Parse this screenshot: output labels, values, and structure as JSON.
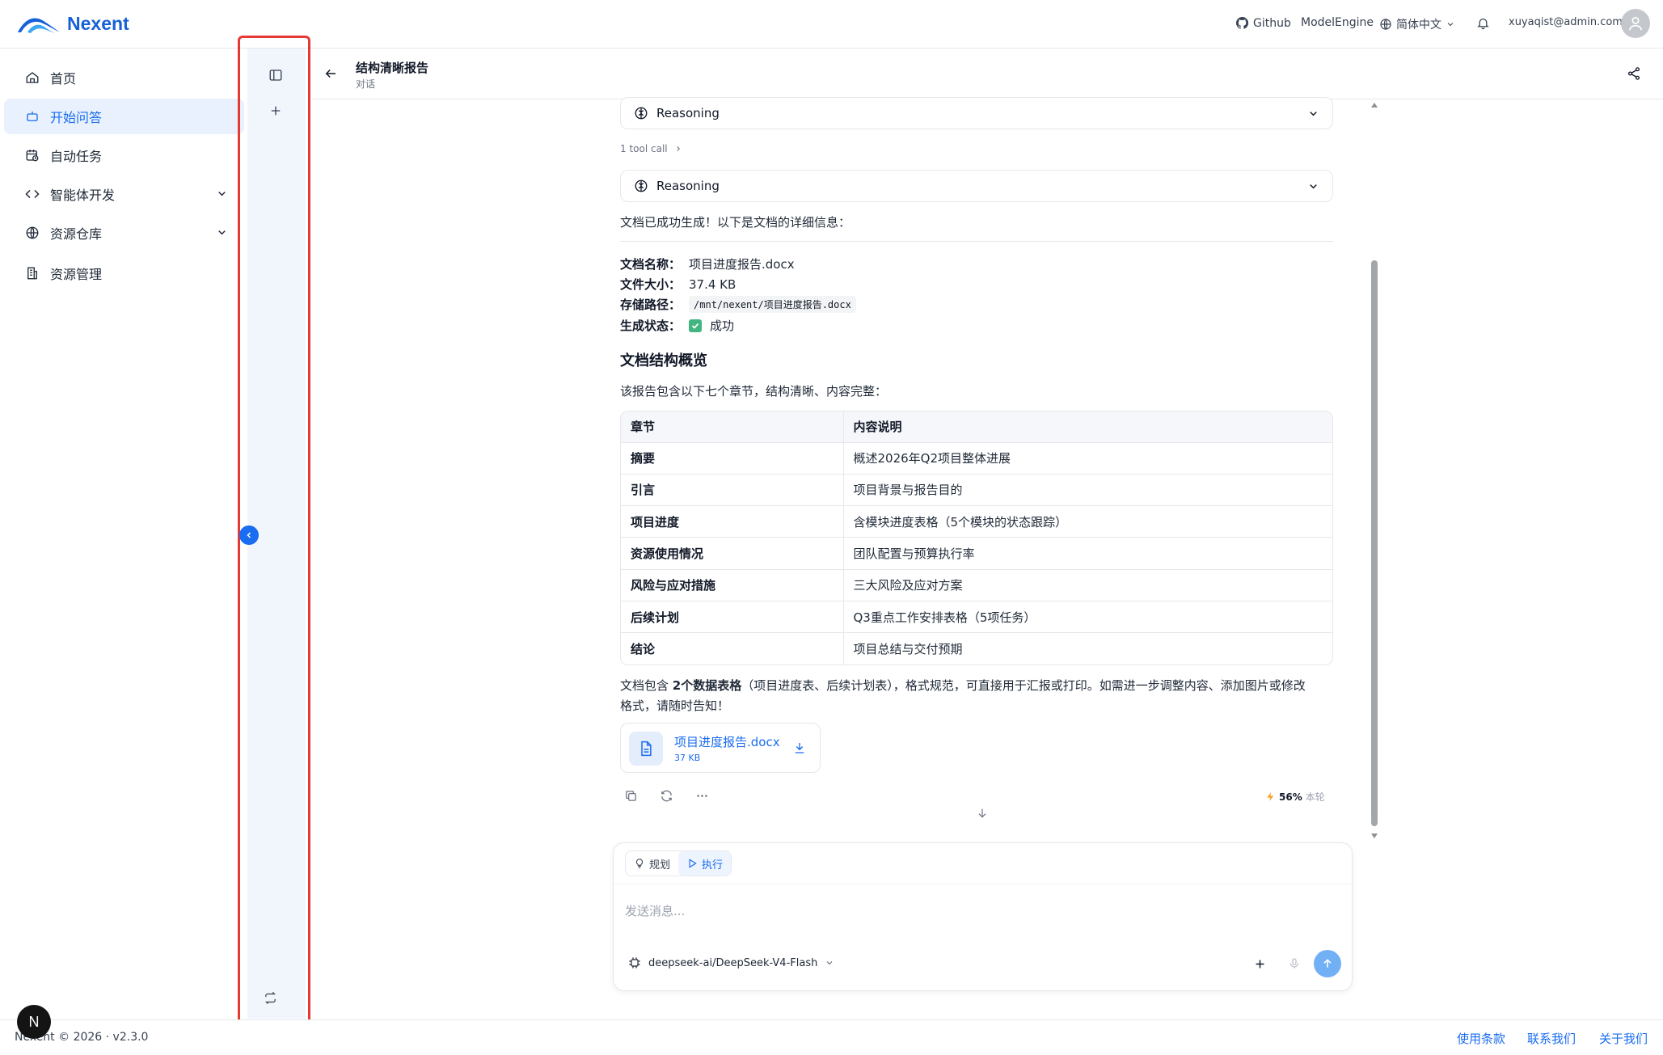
{
  "app": {
    "name": "Nexent"
  },
  "header": {
    "github": "Github",
    "model_engine": "ModelEngine",
    "language": "简体中文",
    "user_email": "xuyaqist@admin.com"
  },
  "nav": {
    "items": [
      {
        "label": "首页",
        "icon": "home-icon"
      },
      {
        "label": "开始问答",
        "icon": "bot-icon",
        "active": true
      },
      {
        "label": "自动任务",
        "icon": "calendar-clock-icon"
      },
      {
        "label": "智能体开发",
        "icon": "code-icon",
        "expandable": true
      },
      {
        "label": "资源仓库",
        "icon": "globe-icon",
        "expandable": true
      },
      {
        "label": "资源管理",
        "icon": "building-icon"
      }
    ]
  },
  "conversation": {
    "title": "结构清晰报告",
    "subtitle": "对话"
  },
  "chat": {
    "reasoning_label": "Reasoning",
    "tool_call": "1 tool call",
    "intro": "文档已成功生成！以下是文档的详细信息：",
    "meta": {
      "name_label": "文档名称：",
      "name_value": "项目进度报告.docx",
      "size_label": "文件大小：",
      "size_value": "37.4 KB",
      "path_label": "存储路径：",
      "path_value": "/mnt/nexent/项目进度报告.docx",
      "status_label": "生成状态：",
      "status_value": "成功"
    },
    "section_title": "文档结构概览",
    "section_intro": "该报告包含以下七个章节，结构清晰、内容完整：",
    "table": {
      "headers": [
        "章节",
        "内容说明"
      ],
      "rows": [
        [
          "摘要",
          "概述2026年Q2项目整体进展"
        ],
        [
          "引言",
          "项目背景与报告目的"
        ],
        [
          "项目进度",
          "含模块进度表格（5个模块的状态跟踪）"
        ],
        [
          "资源使用情况",
          "团队配置与预算执行率"
        ],
        [
          "风险与应对措施",
          "三大风险及应对方案"
        ],
        [
          "后续计划",
          "Q3重点工作安排表格（5项任务）"
        ],
        [
          "结论",
          "项目总结与交付预期"
        ]
      ]
    },
    "summary_pre": "文档包含 ",
    "summary_bold": "2个数据表格",
    "summary_post": "（项目进度表、后续计划表），格式规范，可直接用于汇报或打印。如需进一步调整内容、添加图片或修改",
    "summary_line2": "格式，请随时告知！",
    "file": {
      "name": "项目进度报告.docx",
      "size": "37 KB"
    },
    "usage_percent": "56%",
    "usage_label": "本轮"
  },
  "composer": {
    "mode_plan": "规划",
    "mode_execute": "执行",
    "placeholder": "发送消息...",
    "model": "deepseek-ai/DeepSeek-V4-Flash"
  },
  "footer": {
    "copyright": "Nexent © 2026 · v2.3.0",
    "terms": "使用条款",
    "contact": "联系我们",
    "about": "关于我们",
    "badge": "N"
  },
  "colors": {
    "accent": "#1a6cf0",
    "highlight_box": "#e53935",
    "panel_bg": "#f1f6fd"
  }
}
